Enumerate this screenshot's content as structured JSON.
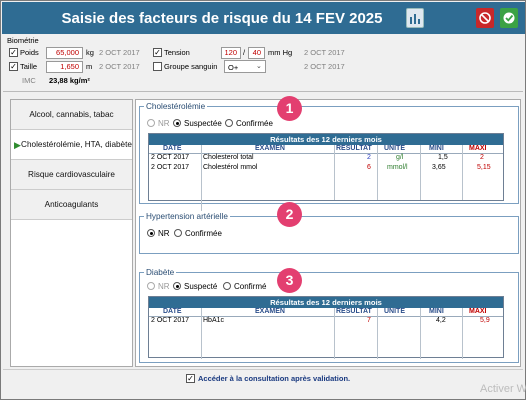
{
  "window": {
    "title": "Saisie des facteurs de risque du 14 FEV 2025"
  },
  "biometrie": {
    "header": "Biométrie",
    "poids": {
      "label": "Poids",
      "value": "65,000",
      "unit": "kg",
      "date": "2 OCT 2017"
    },
    "taille": {
      "label": "Taille",
      "value": "1,650",
      "unit": "m",
      "date": "2 OCT 2017"
    },
    "imc": {
      "label": "IMC",
      "value": "23,88 kg/m²"
    },
    "tension": {
      "label": "Tension",
      "sys": "120",
      "sep": "/",
      "dia": "40",
      "unit": "mm Hg",
      "date": "2 OCT 2017"
    },
    "groupe": {
      "label": "Groupe sanguin",
      "value": "O+",
      "date": "2 OCT 2017"
    }
  },
  "nav": {
    "items": [
      {
        "label": "Alcool, cannabis, tabac"
      },
      {
        "label": "Cholestérolémie, HTA, diabète"
      },
      {
        "label": "Risque cardiovasculaire"
      },
      {
        "label": "Anticoagulants"
      }
    ]
  },
  "chol": {
    "title": "Cholestérolémie",
    "opt_nr": "NR",
    "opt_susp": "Suspectée",
    "opt_conf": "Confirmée",
    "table_title": "Résultats des 12 derniers mois",
    "headers": {
      "date": "DATE",
      "examen": "EXAMEN",
      "resultat": "RESULTAT",
      "unite": "UNITE",
      "mini": "MINI",
      "maxi": "MAXI"
    },
    "rows": [
      {
        "date": "2 OCT 2017",
        "examen": "Cholesterol total",
        "resultat": "2",
        "unite": "g/l",
        "mini": "1,5",
        "maxi": "2"
      },
      {
        "date": "2 OCT 2017",
        "examen": "Cholestérol mmol",
        "resultat": "6",
        "unite": "mmol/l",
        "mini": "3,65",
        "maxi": "5,15"
      }
    ]
  },
  "hta": {
    "title": "Hypertension artérielle",
    "opt_nr": "NR",
    "opt_conf": "Confirmée"
  },
  "diab": {
    "title": "Diabète",
    "opt_nr": "NR",
    "opt_susp": "Suspecté",
    "opt_conf": "Confirmé",
    "table_title": "Résultats des 12 derniers mois",
    "headers": {
      "date": "DATE",
      "examen": "EXAMEN",
      "resultat": "RESULTAT",
      "unite": "UNITE",
      "mini": "MINI",
      "maxi": "MAXI"
    },
    "rows": [
      {
        "date": "2 OCT 2017",
        "examen": "HbA1c",
        "resultat": "7",
        "unite": "",
        "mini": "4,2",
        "maxi": "5,9"
      }
    ]
  },
  "badges": {
    "one": "1",
    "two": "2",
    "three": "3"
  },
  "footer": {
    "checkbox_label": "Accéder à la consultation après validation."
  },
  "watermark": "Activer W",
  "colors": {
    "titlebar": "#2f6c93",
    "badge": "#e33f70",
    "accent": "#2a4d8a"
  }
}
